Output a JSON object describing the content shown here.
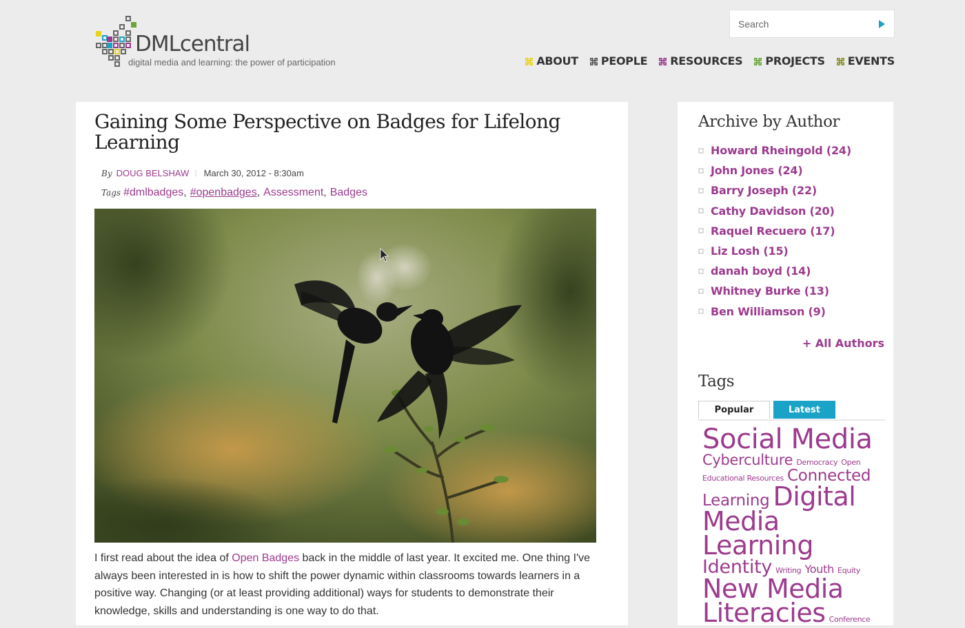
{
  "site": {
    "name": "DMLcentral",
    "tagline": "digital media and learning: the power of participation"
  },
  "search": {
    "placeholder": "Search"
  },
  "nav": [
    {
      "label": "ABOUT",
      "color": "#e8d21c"
    },
    {
      "label": "PEOPLE",
      "color": "#555555"
    },
    {
      "label": "RESOURCES",
      "color": "#9c3b8e"
    },
    {
      "label": "PROJECTS",
      "color": "#6aa53a"
    },
    {
      "label": "EVENTS",
      "color": "#8a8f2a"
    }
  ],
  "article": {
    "title": "Gaining Some Perspective on Badges for Lifelong Learning",
    "by_label": "By",
    "author": "DOUG BELSHAW",
    "date": "March 30, 2012 - 8:30am",
    "tags_label": "Tags",
    "tags": [
      "#dmlbadges",
      "#openbadges",
      "Assessment",
      "Badges"
    ],
    "body": {
      "before_link": "I first read about the idea of ",
      "link": "Open Badges",
      "after_link": " back in the middle of last year. It excited me. One thing I've always been interested in is how to shift the power dynamic within classrooms towards learners in a positive way. Changing (or at least providing additional) ways for students to demonstrate their knowledge, skills and understanding is one way to do that."
    }
  },
  "sidebar": {
    "archive_title": "Archive by Author",
    "authors": [
      "Howard Rheingold (24)",
      "John Jones (24)",
      "Barry Joseph (22)",
      "Cathy Davidson (20)",
      "Raquel Recuero (17)",
      "Liz Losh (15)",
      "danah boyd (14)",
      "Whitney Burke (13)",
      "Ben Williamson (9)"
    ],
    "all_authors": "+ All Authors",
    "tags_title": "Tags",
    "tabs": {
      "popular": "Popular",
      "latest": "Latest"
    },
    "tag_cloud": {
      "social_media": "Social Media",
      "cyberculture": "Cyberculture",
      "democracy": "Democracy",
      "open_educational_resources": "Open Educational Resources",
      "connected_learning": "Connected Learning",
      "digital_media_learning": "Digital Media Learning",
      "identity": "Identity",
      "writing": "Writing",
      "youth": "Youth",
      "equity": "Equity",
      "new_media_literacies": "New Media Literacies",
      "conference": "Conference"
    }
  },
  "colors": {
    "brand_purple": "#9c3b8e",
    "accent_blue": "#1aa3c7",
    "background": "#ececec"
  }
}
